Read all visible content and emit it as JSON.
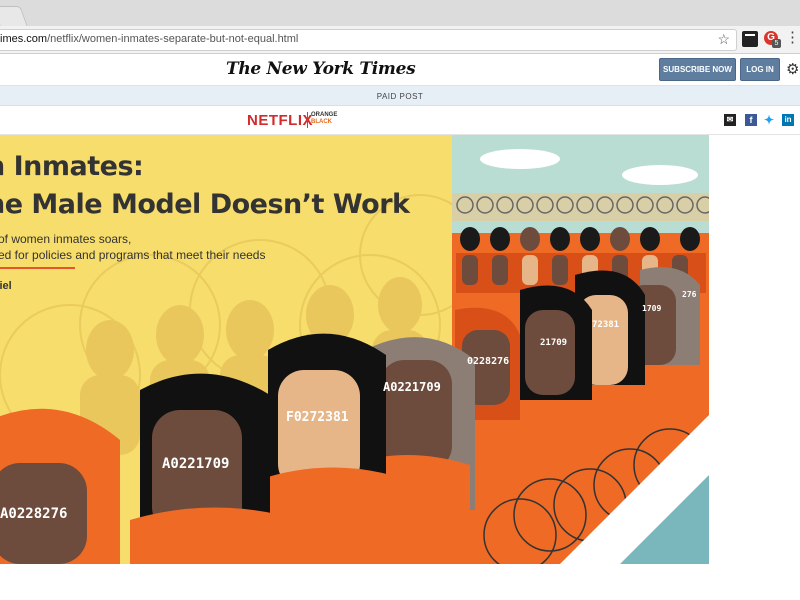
{
  "browser": {
    "url_domain": "imes.com",
    "url_path": "/netflix/women-inmates-separate-but-not-equal.html",
    "star_icon": "star-icon",
    "menu_icon": "kebab-menu-icon",
    "extension_badge": "5"
  },
  "header": {
    "logo": "The New York Times",
    "subscribe_label": "SUBSCRIBE NOW",
    "login_label": "LOG IN",
    "settings_icon": "gear-icon"
  },
  "paid_post": {
    "label": "PAID POST"
  },
  "sponsor": {
    "netflix": "NETFLIX",
    "show_line1": "ORANGE",
    "show_line2": "BLACK",
    "share_icons": [
      "mail-icon",
      "facebook-icon",
      "twitter-icon",
      "linkedin-icon"
    ]
  },
  "article": {
    "title_line1": "n Inmates:",
    "title_line2": "he Male Model Doesn’t Work",
    "dek_line1": "of women inmates soars,",
    "dek_line2": "ed for policies and programs that meet their needs",
    "byline": "ziel"
  },
  "illustration": {
    "tags": [
      "A0228276",
      "A0221709",
      "F0272381",
      "A0221709",
      "0228276",
      "21709",
      "72381",
      "1709",
      "276"
    ],
    "colors": {
      "background": "#f7dd6b",
      "uniform": "#ee6a25",
      "sky": "#b9ddd2",
      "accent": "#e8542a"
    }
  }
}
